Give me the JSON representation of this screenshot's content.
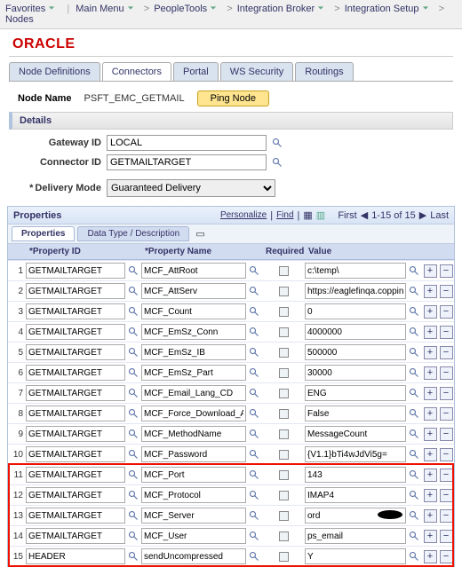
{
  "nav": {
    "favorites": "Favorites",
    "mainmenu": "Main Menu",
    "crumbs": [
      "PeopleTools",
      "Integration Broker",
      "Integration Setup",
      "Nodes"
    ]
  },
  "logo": "ORACLE",
  "tabs": [
    "Node Definitions",
    "Connectors",
    "Portal",
    "WS Security",
    "Routings"
  ],
  "active_tab": 1,
  "node": {
    "label": "Node Name",
    "value": "PSFT_EMC_GETMAIL",
    "ping": "Ping Node"
  },
  "details_heading": "Details",
  "form": {
    "gateway": {
      "label": "Gateway ID",
      "value": "LOCAL"
    },
    "connector": {
      "label": "Connector ID",
      "value": "GETMAILTARGET"
    },
    "delivery": {
      "label": "Delivery Mode",
      "value": "Guaranteed Delivery"
    }
  },
  "props": {
    "title": "Properties",
    "personalize": "Personalize",
    "find": "Find",
    "first": "First",
    "range": "1-15 of 15",
    "last": "Last",
    "subtabs": [
      "Properties",
      "Data Type / Description"
    ],
    "headers": {
      "pid": "*Property ID",
      "pname": "*Property Name",
      "req": "Required",
      "val": "Value"
    },
    "rows": [
      {
        "n": 1,
        "pid": "GETMAILTARGET",
        "pname": "MCF_AttRoot",
        "val": "c:\\temp\\"
      },
      {
        "n": 2,
        "pid": "GETMAILTARGET",
        "pname": "MCF_AttServ",
        "val": "https://eaglefinqa.coppin.edu/PSAttach"
      },
      {
        "n": 3,
        "pid": "GETMAILTARGET",
        "pname": "MCF_Count",
        "val": "0"
      },
      {
        "n": 4,
        "pid": "GETMAILTARGET",
        "pname": "MCF_EmSz_Conn",
        "val": "4000000"
      },
      {
        "n": 5,
        "pid": "GETMAILTARGET",
        "pname": "MCF_EmSz_IB",
        "val": "500000"
      },
      {
        "n": 6,
        "pid": "GETMAILTARGET",
        "pname": "MCF_EmSz_Part",
        "val": "30000"
      },
      {
        "n": 7,
        "pid": "GETMAILTARGET",
        "pname": "MCF_Email_Lang_CD",
        "val": "ENG"
      },
      {
        "n": 8,
        "pid": "GETMAILTARGET",
        "pname": "MCF_Force_Download_A",
        "val": "False"
      },
      {
        "n": 9,
        "pid": "GETMAILTARGET",
        "pname": "MCF_MethodName",
        "val": "MessageCount"
      },
      {
        "n": 10,
        "pid": "GETMAILTARGET",
        "pname": "MCF_Password",
        "val": "{V1.1}bTi4wJdVi5g="
      },
      {
        "n": 11,
        "pid": "GETMAILTARGET",
        "pname": "MCF_Port",
        "val": "143"
      },
      {
        "n": 12,
        "pid": "GETMAILTARGET",
        "pname": "MCF_Protocol",
        "val": "IMAP4"
      },
      {
        "n": 13,
        "pid": "GETMAILTARGET",
        "pname": "MCF_Server",
        "val": "ord",
        "smudge": true
      },
      {
        "n": 14,
        "pid": "GETMAILTARGET",
        "pname": "MCF_User",
        "val": "ps_email"
      },
      {
        "n": 15,
        "pid": "HEADER",
        "pname": "sendUncompressed",
        "val": "Y"
      }
    ],
    "highlight_start": 11,
    "highlight_end": 15
  }
}
